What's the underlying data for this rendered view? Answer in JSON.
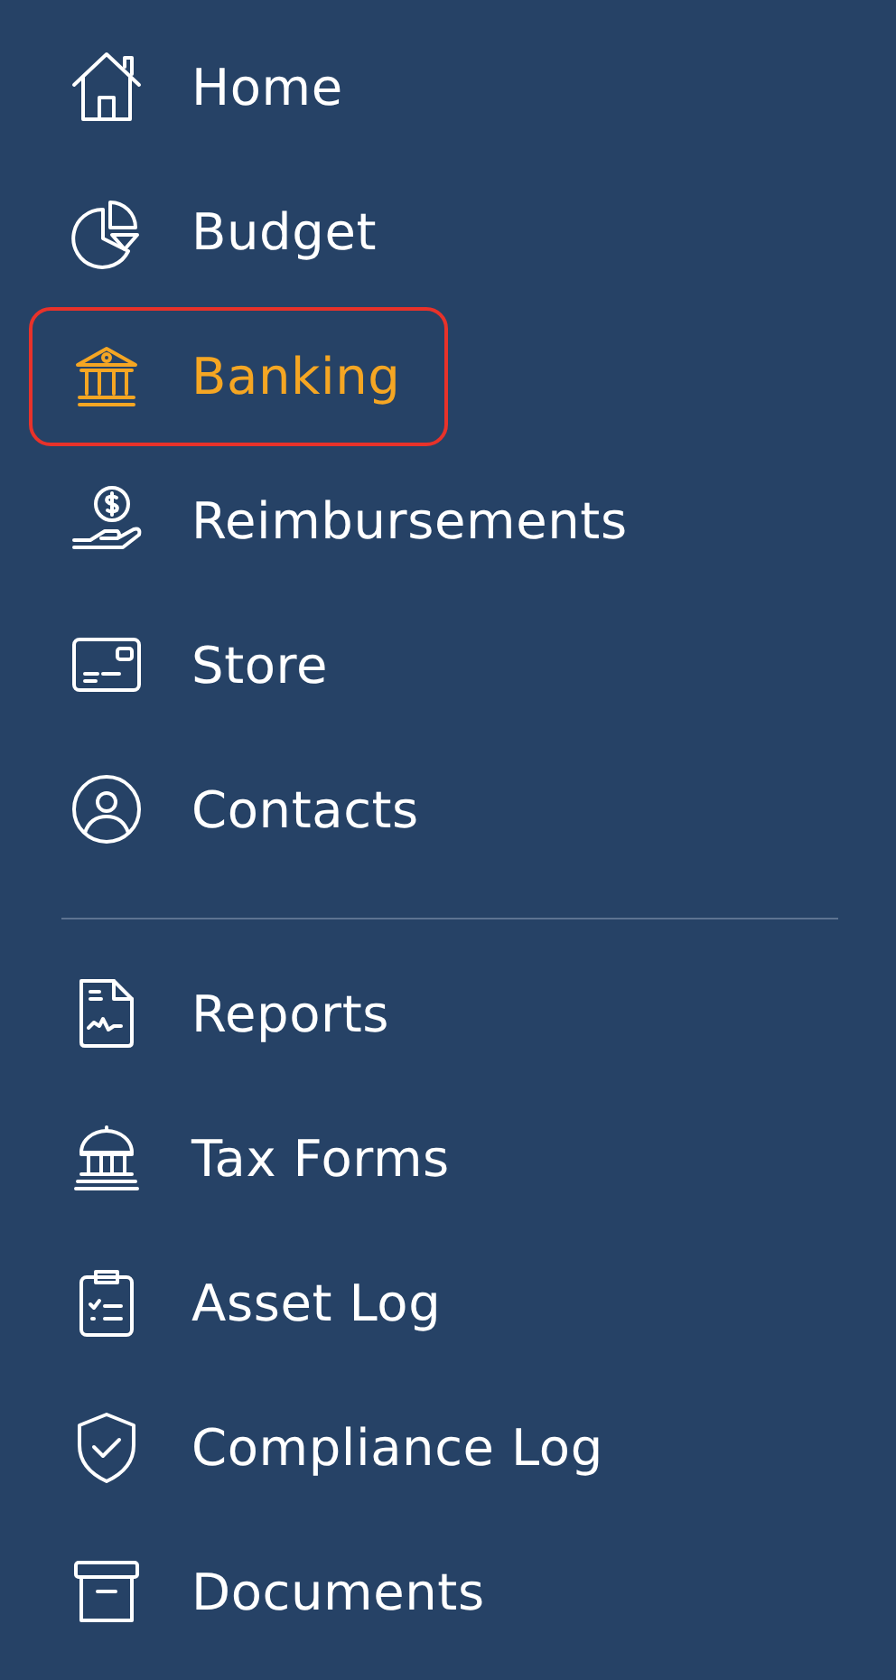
{
  "nav_groups": [
    {
      "items": [
        {
          "label": "Home",
          "selected": false
        },
        {
          "label": "Budget",
          "selected": false
        },
        {
          "label": "Banking",
          "selected": true
        },
        {
          "label": "Reimbursements",
          "selected": false
        },
        {
          "label": "Store",
          "selected": false
        },
        {
          "label": "Contacts",
          "selected": false
        }
      ]
    },
    {
      "items": [
        {
          "label": "Reports",
          "selected": false
        },
        {
          "label": "Tax Forms",
          "selected": false
        },
        {
          "label": "Asset Log",
          "selected": false
        },
        {
          "label": "Compliance Log",
          "selected": false
        },
        {
          "label": "Documents",
          "selected": false
        }
      ]
    }
  ]
}
